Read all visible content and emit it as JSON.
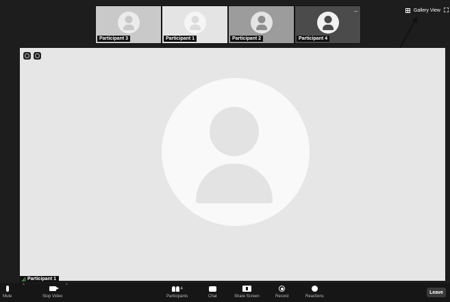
{
  "thumbnails": [
    {
      "name": "Participant 3",
      "bg": "#c9c9c9",
      "avatar_bg": "#ececec",
      "figure": "#c9c9c9"
    },
    {
      "name": "Participant 1",
      "bg": "#e4e4e4",
      "avatar_bg": "#f5f5f5",
      "figure": "#dcdcdc"
    },
    {
      "name": "Participant 2",
      "bg": "#9c9c9c",
      "avatar_bg": "#e4e4e4",
      "figure": "#8f8f8f"
    },
    {
      "name": "Participant 4",
      "bg": "#4b4b4b",
      "avatar_bg": "#f2f2f2",
      "figure": "#4b4b4b"
    }
  ],
  "header": {
    "gallery_view_label": "Gallery View"
  },
  "main": {
    "speaker_name": "Participant 1"
  },
  "toolbar": {
    "mute": "Mute",
    "stop_video": "Stop Video",
    "participants": "Participants",
    "participants_count": "4",
    "chat": "Chat",
    "share_screen": "Share Screen",
    "record": "Record",
    "reactions": "Reactions",
    "leave": "Leave"
  }
}
